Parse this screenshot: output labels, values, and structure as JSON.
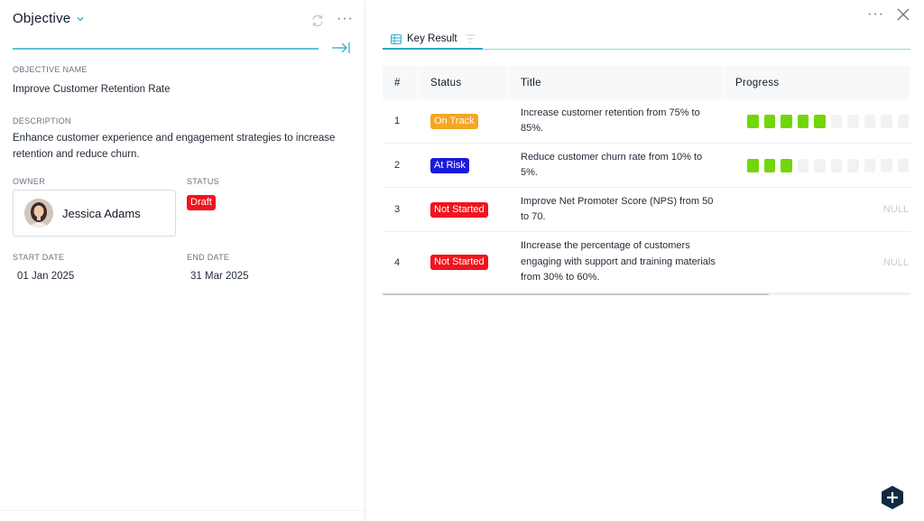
{
  "objective_panel": {
    "title": "Objective",
    "name_label": "OBJECTIVE NAME",
    "name": "Improve Customer Retention Rate",
    "description_label": "DESCRIPTION",
    "description": "Enhance customer experience and engagement strategies to increase retention and reduce churn.",
    "owner_label": "OWNER",
    "owner_name": "Jessica Adams",
    "status_label": "STATUS",
    "status": "Draft",
    "start_label": "START DATE",
    "start_date": "01 Jan 2025",
    "end_label": "END DATE",
    "end_date": "31 Mar 2025"
  },
  "key_result_panel": {
    "tab_label": "Key Result",
    "columns": [
      "#",
      "Status",
      "Title",
      "Progress"
    ],
    "rows": [
      {
        "num": "1",
        "status": "On Track",
        "status_color": "#f5a623",
        "title": "Increase customer retention from 75% to 85%.",
        "progress_filled": 5,
        "progress_total": 10,
        "progress_text": ""
      },
      {
        "num": "2",
        "status": "At Risk",
        "status_color": "#1a1adb",
        "title": "Reduce customer churn rate from 10% to 5%.",
        "progress_filled": 3,
        "progress_total": 10,
        "progress_text": ""
      },
      {
        "num": "3",
        "status": "Not Started",
        "status_color": "#f0141e",
        "title": "Improve Net Promoter Score (NPS) from 50 to 70.",
        "progress_filled": null,
        "progress_total": null,
        "progress_text": "NULL"
      },
      {
        "num": "4",
        "status": "Not Started",
        "status_color": "#f0141e",
        "title": "IIncrease the percentage of customers engaging with support and training materials from 30% to 60%.",
        "progress_filled": null,
        "progress_total": null,
        "progress_text": "NULL"
      }
    ]
  },
  "colors": {
    "accent": "#2aa7c9",
    "progress_fill": "#72d60a",
    "draft_badge": "#f0141e",
    "fab": "#0f2a44"
  },
  "icons": {
    "objective_dropdown": "chevron-down-icon",
    "refresh": "refresh-icon",
    "more": "more-horizontal-icon",
    "collapse": "collapse-right-icon",
    "close": "close-icon",
    "key_result_tab": "table-icon",
    "filter": "filter-icon",
    "add": "plus-icon"
  }
}
